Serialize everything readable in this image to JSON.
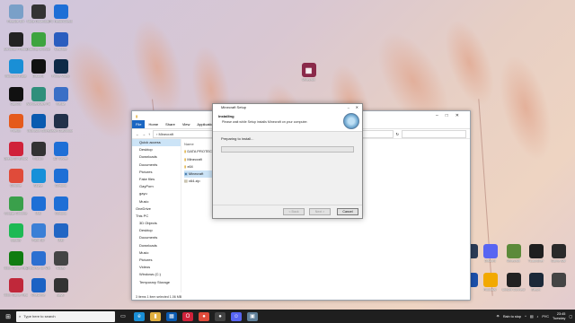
{
  "desktop_icons_left": [
    {
      "label": "Recycle Bin",
      "icon": "recycle-bin-icon",
      "color": "#7aa0c8"
    },
    {
      "label": "Ninja Download",
      "icon": "ninja-icon",
      "color": "#333333"
    },
    {
      "label": "PC HealthCheck",
      "icon": "health-icon",
      "color": "#1e6fd6"
    },
    {
      "label": "Bandicam Recording",
      "icon": "bandicam-icon",
      "color": "#222222"
    },
    {
      "label": "Duckling Browser",
      "icon": "duck-icon",
      "color": "#3da43f"
    },
    {
      "label": "Desktop",
      "icon": "folder-icon",
      "color": "#2a5dbf"
    },
    {
      "label": "Microsoft Edge",
      "icon": "edge-icon",
      "color": "#1a8fd6"
    },
    {
      "label": "Discord",
      "icon": "discord-icon",
      "color": "#111111"
    },
    {
      "label": "Prime Video",
      "icon": "prime-icon",
      "color": "#0f2a47"
    },
    {
      "label": "CapCut",
      "icon": "capcut-icon",
      "color": "#111111"
    },
    {
      "label": "Wondershare Filmora 11",
      "icon": "filmora-icon",
      "color": "#2f8f7b"
    },
    {
      "label": "Media",
      "icon": "media-icon",
      "color": "#3a6fc6"
    },
    {
      "label": "Firefox",
      "icon": "firefox-icon",
      "color": "#e55a1c"
    },
    {
      "label": "Microsoft Store",
      "icon": "store-icon",
      "color": "#0a5ab0"
    },
    {
      "label": "Steam Dashboard",
      "icon": "steam-icon",
      "color": "#22314a"
    },
    {
      "label": "Opera GX Browser",
      "icon": "opera-icon",
      "color": "#d0223a"
    },
    {
      "label": "Roblox",
      "icon": "roblox-icon",
      "color": "#333333"
    },
    {
      "label": "3D Viewer",
      "icon": "viewer-icon",
      "color": "#1e6fd6"
    },
    {
      "label": "Chrome",
      "icon": "chrome-icon",
      "color": "#e04b3a"
    },
    {
      "label": "Skype",
      "icon": "skype-icon",
      "color": "#1790d9"
    },
    {
      "label": "Cortana",
      "icon": "cortana-icon",
      "color": "#1e6fd6"
    },
    {
      "label": "Google Chrome",
      "icon": "gchrome-icon",
      "color": "#3aa04b"
    },
    {
      "label": "Mail",
      "icon": "mail-icon",
      "color": "#1e6fd6"
    },
    {
      "label": "Cortana",
      "icon": "circle-icon",
      "color": "#1e6fd6"
    },
    {
      "label": "Spotify",
      "icon": "spotify-icon",
      "color": "#1db954"
    },
    {
      "label": "Paint 3D",
      "icon": "paint-icon",
      "color": "#3b7fd6"
    },
    {
      "label": "Mail",
      "icon": "envelope-icon",
      "color": "#2266c4"
    },
    {
      "label": "Xbox Game Recovery",
      "icon": "xbox-icon",
      "color": "#107c10"
    },
    {
      "label": "OneDrive for Windows 10",
      "icon": "onedrive-icon",
      "color": "#2b6fd1"
    },
    {
      "label": "Notes",
      "icon": "notes-icon",
      "color": "#444444"
    },
    {
      "label": "Xbox Game Recorder",
      "icon": "game-icon",
      "color": "#c0283a"
    },
    {
      "label": "OneDrive",
      "icon": "cloud-icon",
      "color": "#1b62c4"
    },
    {
      "label": "gayu",
      "icon": "file-icon",
      "color": "#333333"
    }
  ],
  "desktop_icons_right": [
    {
      "label": "",
      "icon": "steam-tile-icon",
      "color": "#2a3a55"
    },
    {
      "label": "Discord",
      "icon": "discord-icon",
      "color": "#5865f2"
    },
    {
      "label": "Minecraft",
      "icon": "minecraft-icon",
      "color": "#5c8a3a"
    },
    {
      "label": "TLauncher",
      "icon": "tlauncher-icon",
      "color": "#1f1f1f"
    },
    {
      "label": "Game Bar",
      "icon": "game-bar-icon",
      "color": "#2a2a2a"
    },
    {
      "label": "",
      "icon": "tile-icon",
      "color": "#1b4fa8"
    },
    {
      "label": "Rockstar",
      "icon": "rockstar-icon",
      "color": "#f2a900"
    },
    {
      "label": "Ubisoft Connect",
      "icon": "ubisoft-icon",
      "color": "#222222"
    },
    {
      "label": "Steam",
      "icon": "steam-logo-icon",
      "color": "#1b2838"
    },
    {
      "label": "",
      "icon": "app-icon",
      "color": "#444444"
    }
  ],
  "winrar_icon_label": "Minecraft",
  "explorer": {
    "title": "",
    "tabs": [
      "File",
      "Home",
      "Share",
      "View",
      "Application Tools"
    ],
    "address": "Minecraft",
    "nav_items": [
      "Quick access",
      "Desktop",
      "Downloads",
      "Documents",
      "Pictures",
      "Fake files",
      "GayPorn",
      "gayu",
      "Music",
      "OneDrive",
      "This PC",
      "3D Objects",
      "Desktop",
      "Documents",
      "Downloads",
      "Music",
      "Pictures",
      "Videos",
      "Windows (C:)",
      "Temporary Storage"
    ],
    "column_header": "Name",
    "files": [
      "DATA PROTECTED",
      "Minecraft",
      "x64",
      "Minecraft",
      "x64.zip"
    ],
    "status": "3 items    1 item selected  1.06 MB"
  },
  "setup": {
    "title": "Minecraft Setup",
    "heading": "Installing",
    "subheading": "Please wait while Setup installs Minecraft on your computer.",
    "status": "Preparing to install...",
    "progress": 0,
    "buttons": [
      "< Back",
      "Next >",
      "Cancel"
    ]
  },
  "taskbar": {
    "search_placeholder": "Type here to search",
    "tray_text": "Rain to stop",
    "lang": "РУС",
    "time": "23:45",
    "day": "Tuesday"
  }
}
